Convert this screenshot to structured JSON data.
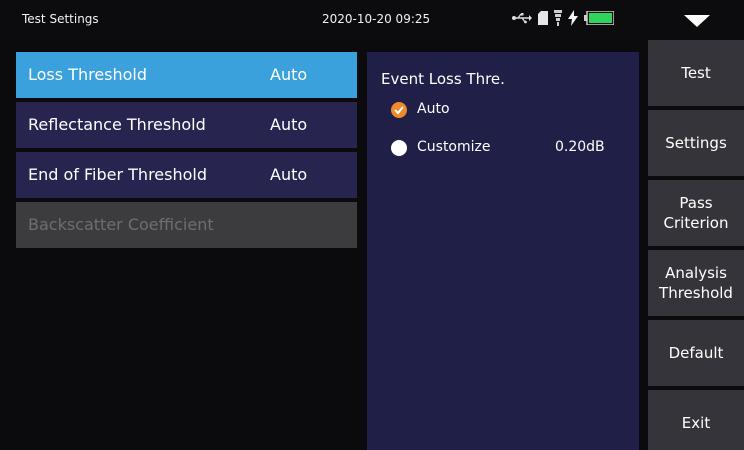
{
  "status_bar": {
    "title": "Test Settings",
    "datetime": "2020-10-20 09:25",
    "icons": [
      "usb-icon",
      "sd-card-icon",
      "signal-icon",
      "charging-bolt-icon",
      "battery-icon"
    ],
    "battery_color": "#2fd45a"
  },
  "threshold_list": {
    "items": [
      {
        "label": "Loss Threshold",
        "value": "Auto",
        "state": "active"
      },
      {
        "label": "Reflectance Threshold",
        "value": "Auto",
        "state": "normal"
      },
      {
        "label": "End of Fiber Threshold",
        "value": "Auto",
        "state": "normal"
      },
      {
        "label": "Backscatter Coefficient",
        "value": "",
        "state": "disabled"
      }
    ]
  },
  "panel": {
    "title": "Event Loss Thre.",
    "options": [
      {
        "label": "Auto",
        "value": "",
        "checked": true
      },
      {
        "label": "Customize",
        "value": "0.20dB",
        "checked": false
      }
    ]
  },
  "side_menu": {
    "buttons": [
      "Test",
      "Settings",
      "Pass\nCriterion",
      "Analysis\nThreshold",
      "Default",
      "Exit"
    ]
  },
  "colors": {
    "active": "#3aa1dd",
    "item_bg": "#272550",
    "panel_bg": "#201f48",
    "check": "#ef8a2b",
    "side_button": "#34343a"
  }
}
